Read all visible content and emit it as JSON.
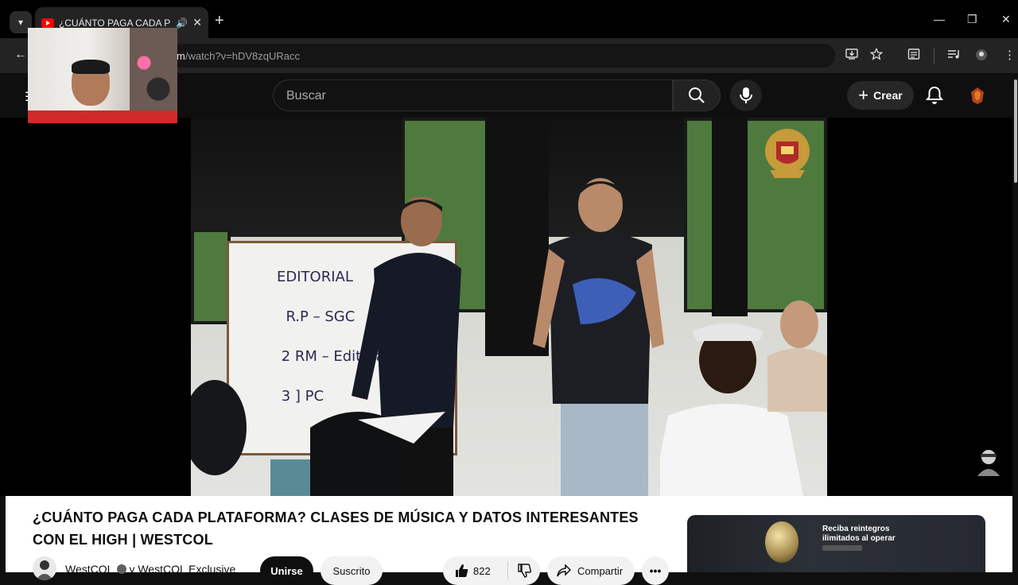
{
  "browser": {
    "tab_title": "¿CUÁNTO PAGA CADA PLATAFORMA? CLASES DE MÚSICA",
    "url_host_suffix": "m",
    "url_path": "/watch?v=hDV8zqURacc",
    "new_tab_symbol": "+",
    "tab_close_symbol": "✕",
    "window_controls": {
      "minimize": "—",
      "restore": "❐",
      "close": "✕"
    }
  },
  "youtube_header": {
    "search_placeholder": "Buscar",
    "create_label": "Crear",
    "create_symbol": "+"
  },
  "video": {
    "board_text": "EDITORIAL\n  R.P – SGC\n 2 RM – Editora\n 3 ] PC"
  },
  "details": {
    "title": "¿CUÁNTO PAGA CADA PLATAFORMA? CLASES DE MÚSICA Y DATOS INTERESANTES CON EL HIGH | WESTCOL",
    "channel_name": "WestCOL",
    "channel_suffix": "y WestCOL Exclusive",
    "join_label": "Unirse",
    "subscribed_label": "Suscrito",
    "like_count": "822",
    "share_label": "Compartir",
    "more_symbol": "•••"
  },
  "ad": {
    "text": "Reciba reintegros ilimitados al operar"
  },
  "colors": {
    "background": "#0f0f0f",
    "youtube_red": "#ff0000",
    "surface": "#ffffff"
  }
}
